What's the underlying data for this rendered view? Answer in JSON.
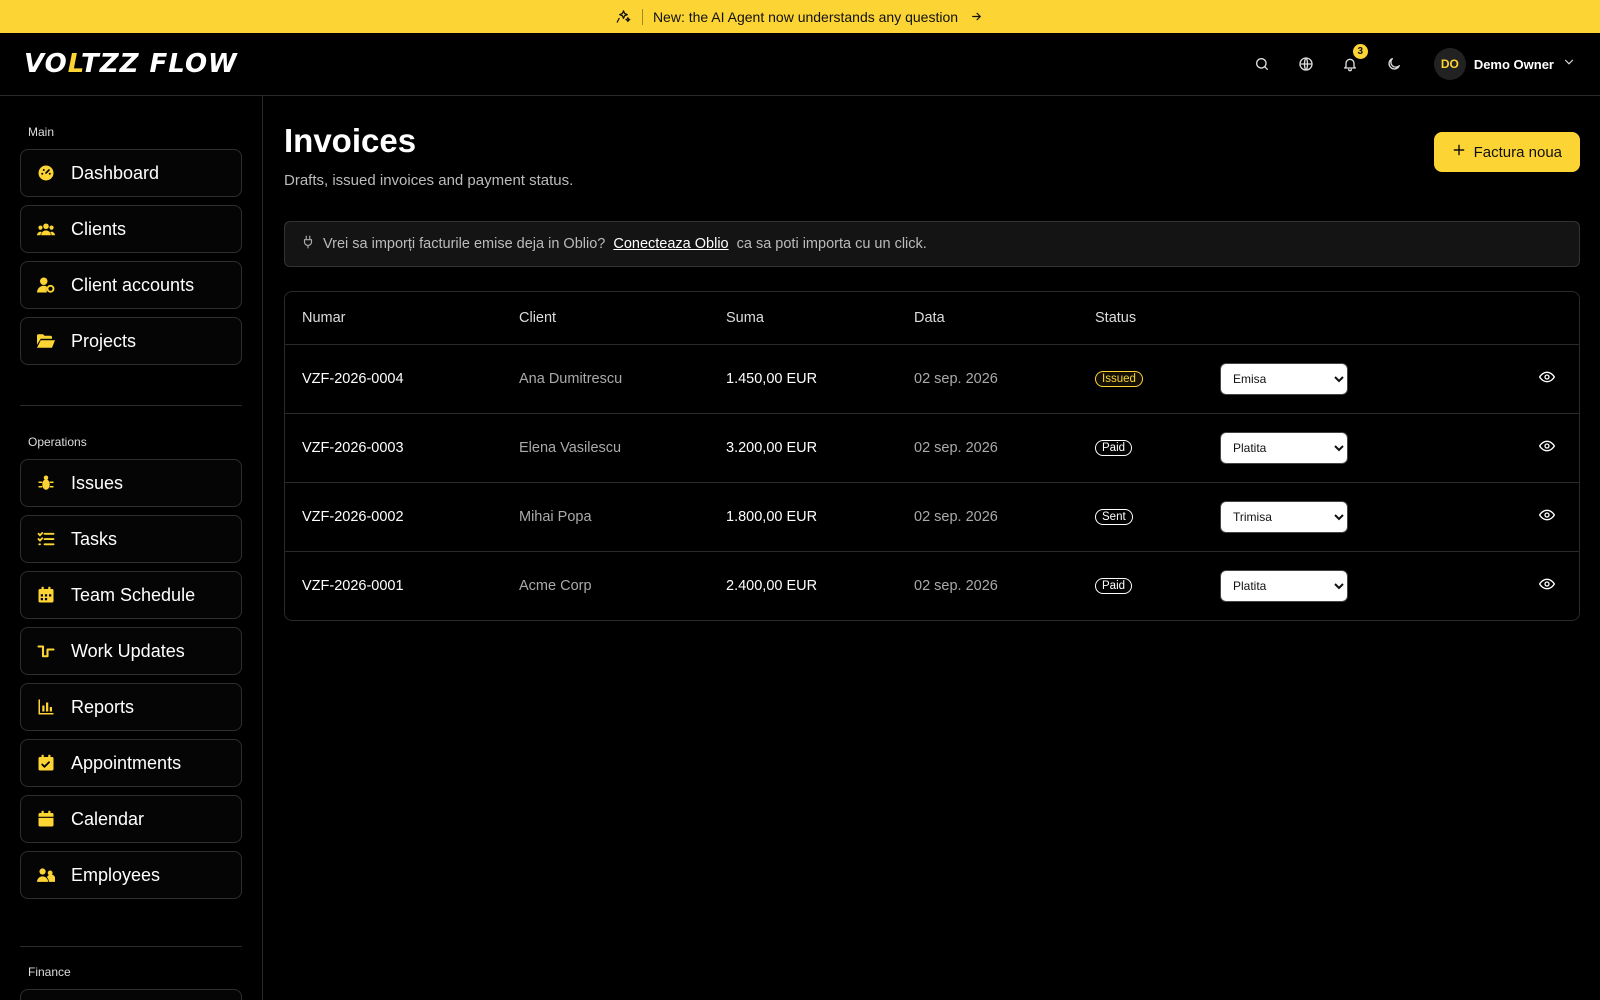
{
  "announcement": {
    "text": "New: the AI Agent now understands any question"
  },
  "header": {
    "logo_a": "VO",
    "logo_accent": "L",
    "logo_b": "TZZ FLOW",
    "notifications_count": "3",
    "user_initials": "DO",
    "user_name": "Demo Owner"
  },
  "sidebar": {
    "sections": [
      {
        "label": "Main",
        "items": [
          "Dashboard",
          "Clients",
          "Client accounts",
          "Projects"
        ]
      },
      {
        "label": "Operations",
        "items": [
          "Issues",
          "Tasks",
          "Team Schedule",
          "Work Updates",
          "Reports",
          "Appointments",
          "Calendar",
          "Employees"
        ]
      },
      {
        "label": "Finance",
        "items": []
      }
    ]
  },
  "main": {
    "title": "Invoices",
    "subtitle": "Drafts, issued invoices and payment status.",
    "new_button": "Factura noua",
    "info": {
      "text_before": "Vrei sa imporți facturile emise deja in Oblio?",
      "link": "Conecteaza Oblio",
      "text_after": "ca sa poti importa cu un click."
    },
    "table": {
      "headers": [
        "Numar",
        "Client",
        "Suma",
        "Data",
        "Status"
      ],
      "rows": [
        {
          "numar": "VZF-2026-0004",
          "client": "Ana Dumitrescu",
          "suma": "1.450,00 EUR",
          "data": "02 sep. 2026",
          "status": "Issued",
          "select": "Emisa"
        },
        {
          "numar": "VZF-2026-0003",
          "client": "Elena Vasilescu",
          "suma": "3.200,00 EUR",
          "data": "02 sep. 2026",
          "status": "Paid",
          "select": "Platita"
        },
        {
          "numar": "VZF-2026-0002",
          "client": "Mihai Popa",
          "suma": "1.800,00 EUR",
          "data": "02 sep. 2026",
          "status": "Sent",
          "select": "Trimisa"
        },
        {
          "numar": "VZF-2026-0001",
          "client": "Acme Corp",
          "suma": "2.400,00 EUR",
          "data": "02 sep. 2026",
          "status": "Paid",
          "select": "Platita"
        }
      ]
    }
  },
  "colors": {
    "accent": "#fcd535",
    "background": "#000000",
    "border": "#2a2a2a"
  }
}
